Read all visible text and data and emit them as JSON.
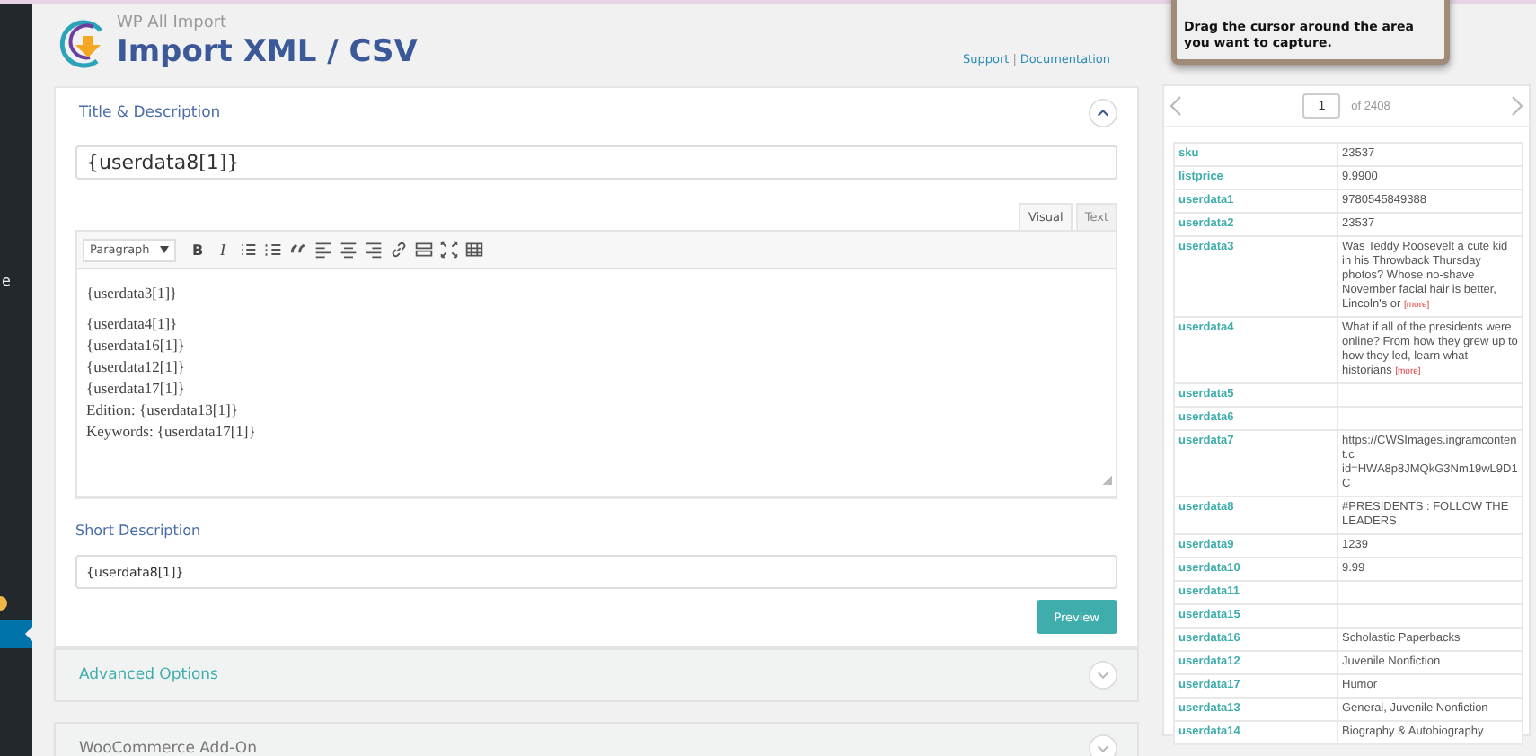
{
  "sidebar": {
    "fragment": "e",
    "items": [
      {
        "kind": "notice"
      },
      {
        "kind": "item",
        "selected": true
      }
    ]
  },
  "header": {
    "subtitle": "WP All Import",
    "title": "Import XML / CSV",
    "links": [
      "Support",
      "Documentation"
    ],
    "separator": "|"
  },
  "capture_tip": {
    "text": "Drag the cursor around the area you want to capture."
  },
  "sections": [
    {
      "title": "Title & Description",
      "expanded": true,
      "kind": "editor",
      "title_field": {
        "value": "{userdata8[1]}"
      },
      "editor_tabs": [
        {
          "label": "Visual",
          "selected": true
        },
        {
          "label": "Text",
          "selected": false
        }
      ],
      "format_select": {
        "value": "Paragraph"
      },
      "toolbar": [
        {
          "kind": "bold",
          "label": "B"
        },
        {
          "kind": "italic",
          "label": "I"
        },
        {
          "kind": "bullets"
        },
        {
          "kind": "numbers"
        },
        {
          "kind": "quote"
        },
        {
          "kind": "align-left"
        },
        {
          "kind": "align-center"
        },
        {
          "kind": "align-right"
        },
        {
          "kind": "link"
        },
        {
          "kind": "more"
        },
        {
          "kind": "fullscreen"
        },
        {
          "kind": "toolbar"
        }
      ],
      "paragraphs": [
        [
          "{userdata3[1]}"
        ],
        [
          "{userdata4[1]}",
          "{userdata16[1]}",
          "{userdata12[1]}",
          "{userdata17[1]}",
          "Edition: {userdata13[1]}",
          "Keywords: {userdata17[1]}"
        ]
      ],
      "short_description": {
        "label": "Short Description",
        "value": "{userdata8[1]}"
      },
      "button": "Preview"
    },
    {
      "title": "Advanced Options",
      "expanded": false,
      "kind": "plain"
    },
    {
      "title": "WooCommerce Add-On",
      "expanded": false,
      "kind": "plain"
    }
  ],
  "record_panel": {
    "page": "1",
    "total": "of 2408",
    "rows": [
      {
        "key": "sku",
        "value": "23537"
      },
      {
        "key": "listprice",
        "value": "9.9900"
      },
      {
        "key": "userdata1",
        "value": "9780545849388"
      },
      {
        "key": "userdata2",
        "value": "23537"
      },
      {
        "key": "userdata3",
        "value": "Was Teddy Roosevelt a cute kid in his Throwback Thursday photos? Whose no-shave November facial hair is better, Lincoln's or",
        "more": "[more]"
      },
      {
        "key": "userdata4",
        "value": "What if all of the presidents were online? From how they grew up to how they led, learn what historians",
        "more": "[more]"
      },
      {
        "key": "userdata5",
        "value": ""
      },
      {
        "key": "userdata6",
        "value": ""
      },
      {
        "key": "userdata7",
        "value": "https://CWSImages.ingramcontent.c id=HWA8p8JMQkG3Nm19wL9D1C"
      },
      {
        "key": "userdata8",
        "value": "#PRESIDENTS : FOLLOW THE LEADERS"
      },
      {
        "key": "userdata9",
        "value": "1239"
      },
      {
        "key": "userdata10",
        "value": "9.99"
      },
      {
        "key": "userdata11",
        "value": ""
      },
      {
        "key": "userdata15",
        "value": ""
      },
      {
        "key": "userdata16",
        "value": "Scholastic Paperbacks"
      },
      {
        "key": "userdata12",
        "value": "Juvenile Nonfiction"
      },
      {
        "key": "userdata17",
        "value": "Humor"
      },
      {
        "key": "userdata13",
        "value": "General, Juvenile Nonfiction"
      },
      {
        "key": "userdata14",
        "value": "Biography & Autobiography"
      }
    ]
  }
}
